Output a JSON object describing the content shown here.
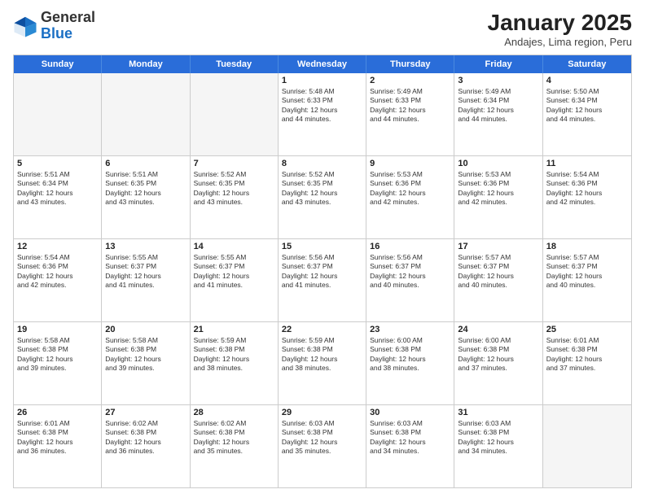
{
  "header": {
    "logo_general": "General",
    "logo_blue": "Blue",
    "month_title": "January 2025",
    "subtitle": "Andajes, Lima region, Peru"
  },
  "days_of_week": [
    "Sunday",
    "Monday",
    "Tuesday",
    "Wednesday",
    "Thursday",
    "Friday",
    "Saturday"
  ],
  "weeks": [
    [
      {
        "day": "",
        "info": ""
      },
      {
        "day": "",
        "info": ""
      },
      {
        "day": "",
        "info": ""
      },
      {
        "day": "1",
        "info": "Sunrise: 5:48 AM\nSunset: 6:33 PM\nDaylight: 12 hours\nand 44 minutes."
      },
      {
        "day": "2",
        "info": "Sunrise: 5:49 AM\nSunset: 6:33 PM\nDaylight: 12 hours\nand 44 minutes."
      },
      {
        "day": "3",
        "info": "Sunrise: 5:49 AM\nSunset: 6:34 PM\nDaylight: 12 hours\nand 44 minutes."
      },
      {
        "day": "4",
        "info": "Sunrise: 5:50 AM\nSunset: 6:34 PM\nDaylight: 12 hours\nand 44 minutes."
      }
    ],
    [
      {
        "day": "5",
        "info": "Sunrise: 5:51 AM\nSunset: 6:34 PM\nDaylight: 12 hours\nand 43 minutes."
      },
      {
        "day": "6",
        "info": "Sunrise: 5:51 AM\nSunset: 6:35 PM\nDaylight: 12 hours\nand 43 minutes."
      },
      {
        "day": "7",
        "info": "Sunrise: 5:52 AM\nSunset: 6:35 PM\nDaylight: 12 hours\nand 43 minutes."
      },
      {
        "day": "8",
        "info": "Sunrise: 5:52 AM\nSunset: 6:35 PM\nDaylight: 12 hours\nand 43 minutes."
      },
      {
        "day": "9",
        "info": "Sunrise: 5:53 AM\nSunset: 6:36 PM\nDaylight: 12 hours\nand 42 minutes."
      },
      {
        "day": "10",
        "info": "Sunrise: 5:53 AM\nSunset: 6:36 PM\nDaylight: 12 hours\nand 42 minutes."
      },
      {
        "day": "11",
        "info": "Sunrise: 5:54 AM\nSunset: 6:36 PM\nDaylight: 12 hours\nand 42 minutes."
      }
    ],
    [
      {
        "day": "12",
        "info": "Sunrise: 5:54 AM\nSunset: 6:36 PM\nDaylight: 12 hours\nand 42 minutes."
      },
      {
        "day": "13",
        "info": "Sunrise: 5:55 AM\nSunset: 6:37 PM\nDaylight: 12 hours\nand 41 minutes."
      },
      {
        "day": "14",
        "info": "Sunrise: 5:55 AM\nSunset: 6:37 PM\nDaylight: 12 hours\nand 41 minutes."
      },
      {
        "day": "15",
        "info": "Sunrise: 5:56 AM\nSunset: 6:37 PM\nDaylight: 12 hours\nand 41 minutes."
      },
      {
        "day": "16",
        "info": "Sunrise: 5:56 AM\nSunset: 6:37 PM\nDaylight: 12 hours\nand 40 minutes."
      },
      {
        "day": "17",
        "info": "Sunrise: 5:57 AM\nSunset: 6:37 PM\nDaylight: 12 hours\nand 40 minutes."
      },
      {
        "day": "18",
        "info": "Sunrise: 5:57 AM\nSunset: 6:37 PM\nDaylight: 12 hours\nand 40 minutes."
      }
    ],
    [
      {
        "day": "19",
        "info": "Sunrise: 5:58 AM\nSunset: 6:38 PM\nDaylight: 12 hours\nand 39 minutes."
      },
      {
        "day": "20",
        "info": "Sunrise: 5:58 AM\nSunset: 6:38 PM\nDaylight: 12 hours\nand 39 minutes."
      },
      {
        "day": "21",
        "info": "Sunrise: 5:59 AM\nSunset: 6:38 PM\nDaylight: 12 hours\nand 38 minutes."
      },
      {
        "day": "22",
        "info": "Sunrise: 5:59 AM\nSunset: 6:38 PM\nDaylight: 12 hours\nand 38 minutes."
      },
      {
        "day": "23",
        "info": "Sunrise: 6:00 AM\nSunset: 6:38 PM\nDaylight: 12 hours\nand 38 minutes."
      },
      {
        "day": "24",
        "info": "Sunrise: 6:00 AM\nSunset: 6:38 PM\nDaylight: 12 hours\nand 37 minutes."
      },
      {
        "day": "25",
        "info": "Sunrise: 6:01 AM\nSunset: 6:38 PM\nDaylight: 12 hours\nand 37 minutes."
      }
    ],
    [
      {
        "day": "26",
        "info": "Sunrise: 6:01 AM\nSunset: 6:38 PM\nDaylight: 12 hours\nand 36 minutes."
      },
      {
        "day": "27",
        "info": "Sunrise: 6:02 AM\nSunset: 6:38 PM\nDaylight: 12 hours\nand 36 minutes."
      },
      {
        "day": "28",
        "info": "Sunrise: 6:02 AM\nSunset: 6:38 PM\nDaylight: 12 hours\nand 35 minutes."
      },
      {
        "day": "29",
        "info": "Sunrise: 6:03 AM\nSunset: 6:38 PM\nDaylight: 12 hours\nand 35 minutes."
      },
      {
        "day": "30",
        "info": "Sunrise: 6:03 AM\nSunset: 6:38 PM\nDaylight: 12 hours\nand 34 minutes."
      },
      {
        "day": "31",
        "info": "Sunrise: 6:03 AM\nSunset: 6:38 PM\nDaylight: 12 hours\nand 34 minutes."
      },
      {
        "day": "",
        "info": ""
      }
    ]
  ]
}
